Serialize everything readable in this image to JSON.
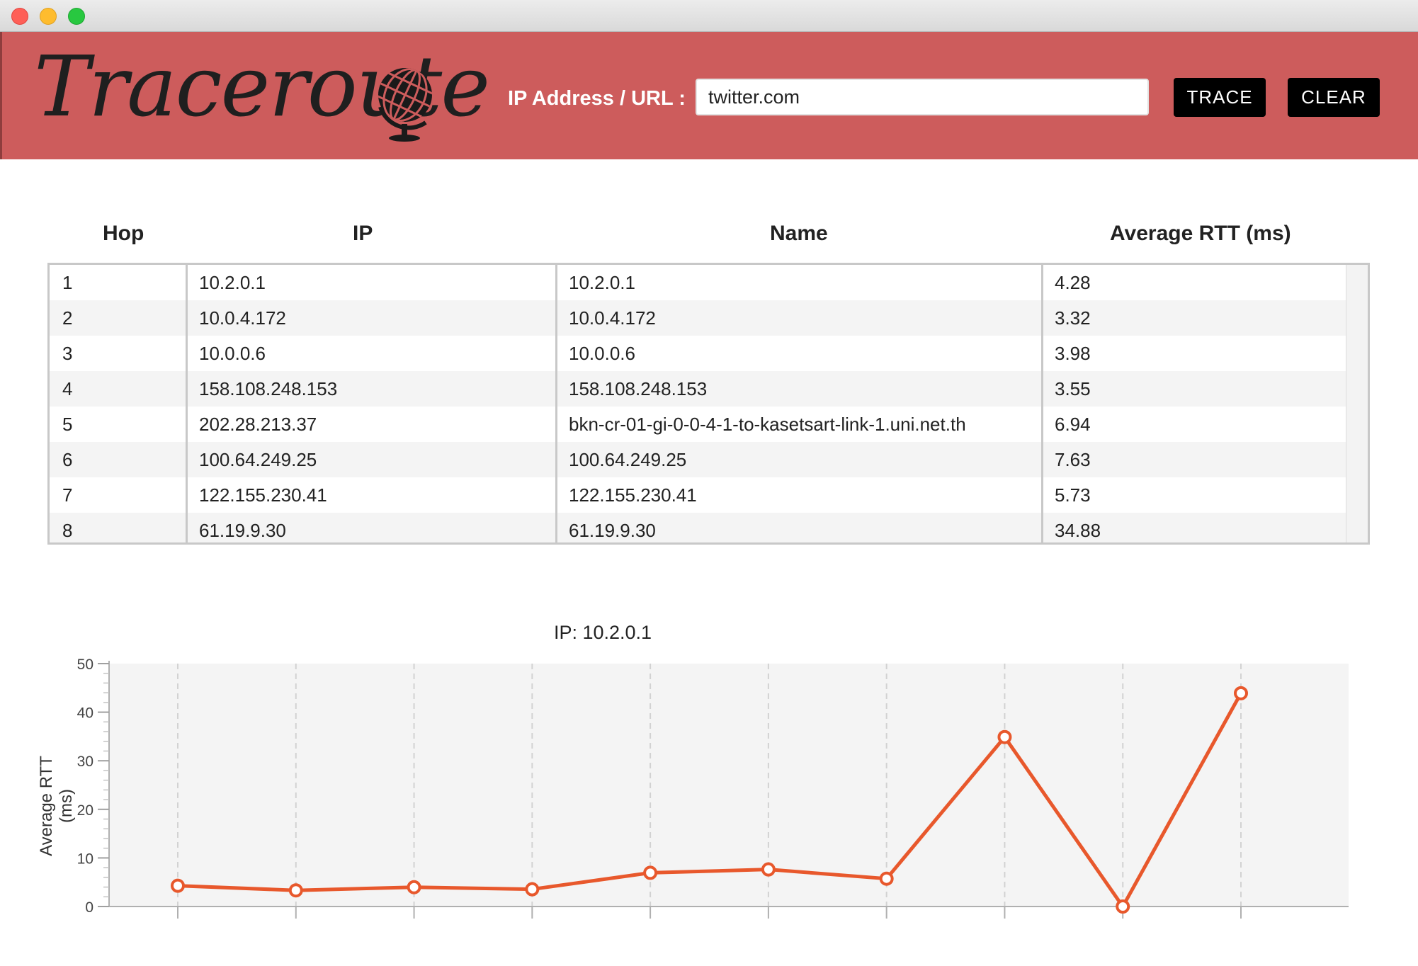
{
  "header": {
    "app_title": "Traceroute",
    "input_label": "IP Address / URL :",
    "input_value": "twitter.com",
    "trace_label": "TRACE",
    "clear_label": "CLEAR",
    "brand_color": "#cd5c5c"
  },
  "table": {
    "columns": [
      "Hop",
      "IP",
      "Name",
      "Average RTT (ms)"
    ],
    "rows": [
      [
        "1",
        "10.2.0.1",
        "10.2.0.1",
        "4.28"
      ],
      [
        "2",
        "10.0.4.172",
        "10.0.4.172",
        "3.32"
      ],
      [
        "3",
        "10.0.0.6",
        "10.0.0.6",
        "3.98"
      ],
      [
        "4",
        "158.108.248.153",
        "158.108.248.153",
        "3.55"
      ],
      [
        "5",
        "202.28.213.37",
        "bkn-cr-01-gi-0-0-4-1-to-kasetsart-link-1.uni.net.th",
        "6.94"
      ],
      [
        "6",
        "100.64.249.25",
        "100.64.249.25",
        "7.63"
      ],
      [
        "7",
        "122.155.230.41",
        "122.155.230.41",
        "5.73"
      ],
      [
        "8",
        "61.19.9.30",
        "61.19.9.30",
        "34.88"
      ]
    ]
  },
  "chart_data": {
    "type": "line",
    "title": "IP: 10.2.0.1",
    "xlabel": "",
    "ylabel": "Average RTT (ms)",
    "ylim": [
      0,
      50
    ],
    "yticks": [
      0,
      10,
      20,
      30,
      40,
      50
    ],
    "x": [
      1,
      2,
      3,
      4,
      5,
      6,
      7,
      8,
      9,
      10
    ],
    "series": [
      {
        "values": [
          4.28,
          3.32,
          3.98,
          3.55,
          6.94,
          7.63,
          5.73,
          34.88,
          0,
          43.9
        ]
      }
    ],
    "grid": "vertical dashed",
    "line_color": "#e8582c",
    "plot_background": "#f4f4f4"
  }
}
